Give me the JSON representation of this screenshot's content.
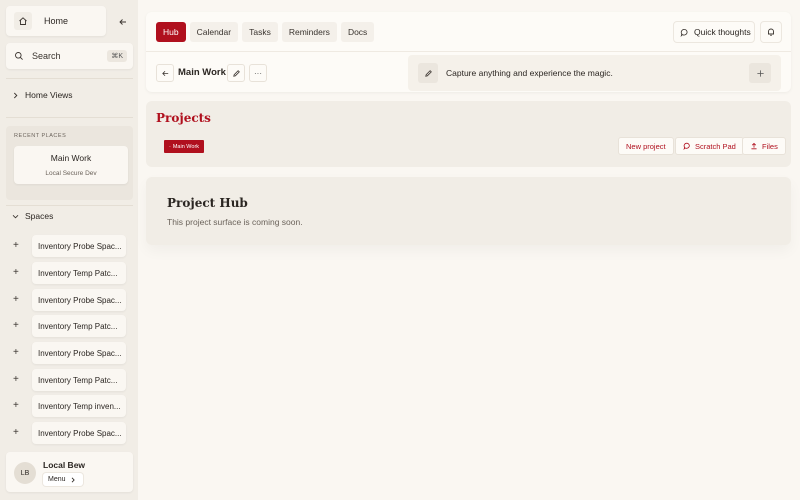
{
  "sidebar": {
    "home_label": "Home",
    "search_label": "Search",
    "search_shortcut": "⌘K",
    "home_views_label": "Home Views",
    "recent_title": "RECENT PLACES",
    "recent_item": {
      "title": "Main Work",
      "subtitle": "Local Secure Dev"
    },
    "spaces_label": "Spaces",
    "spaces": [
      "Inventory Probe Spac...",
      "Inventory Temp Patc...",
      "Inventory Probe Spac...",
      "Inventory Temp Patc...",
      "Inventory Probe Spac...",
      "Inventory Temp Patc...",
      "Inventory Temp inven...",
      "Inventory Probe Spac..."
    ],
    "user": {
      "initials": "LB",
      "name": "Local Bew",
      "menu_label": "Menu"
    }
  },
  "header": {
    "tabs": [
      "Hub",
      "Calendar",
      "Tasks",
      "Reminders",
      "Docs"
    ],
    "active_tab": "Hub",
    "quick_thoughts_label": "Quick thoughts",
    "workspace_title": "Main Work",
    "more_label": "···",
    "capture_placeholder": "Capture anything and experience the magic."
  },
  "projects": {
    "title": "Projects",
    "chip_label": "Main Work",
    "new_project_label": "New project",
    "scratch_pad_label": "Scratch Pad",
    "files_label": "Files"
  },
  "hub": {
    "title": "Project Hub",
    "subtitle": "This project surface is coming soon."
  },
  "colors": {
    "accent": "#b0101e",
    "sidebar_bg": "#f1ede6",
    "page_bg": "#faf7f2"
  }
}
